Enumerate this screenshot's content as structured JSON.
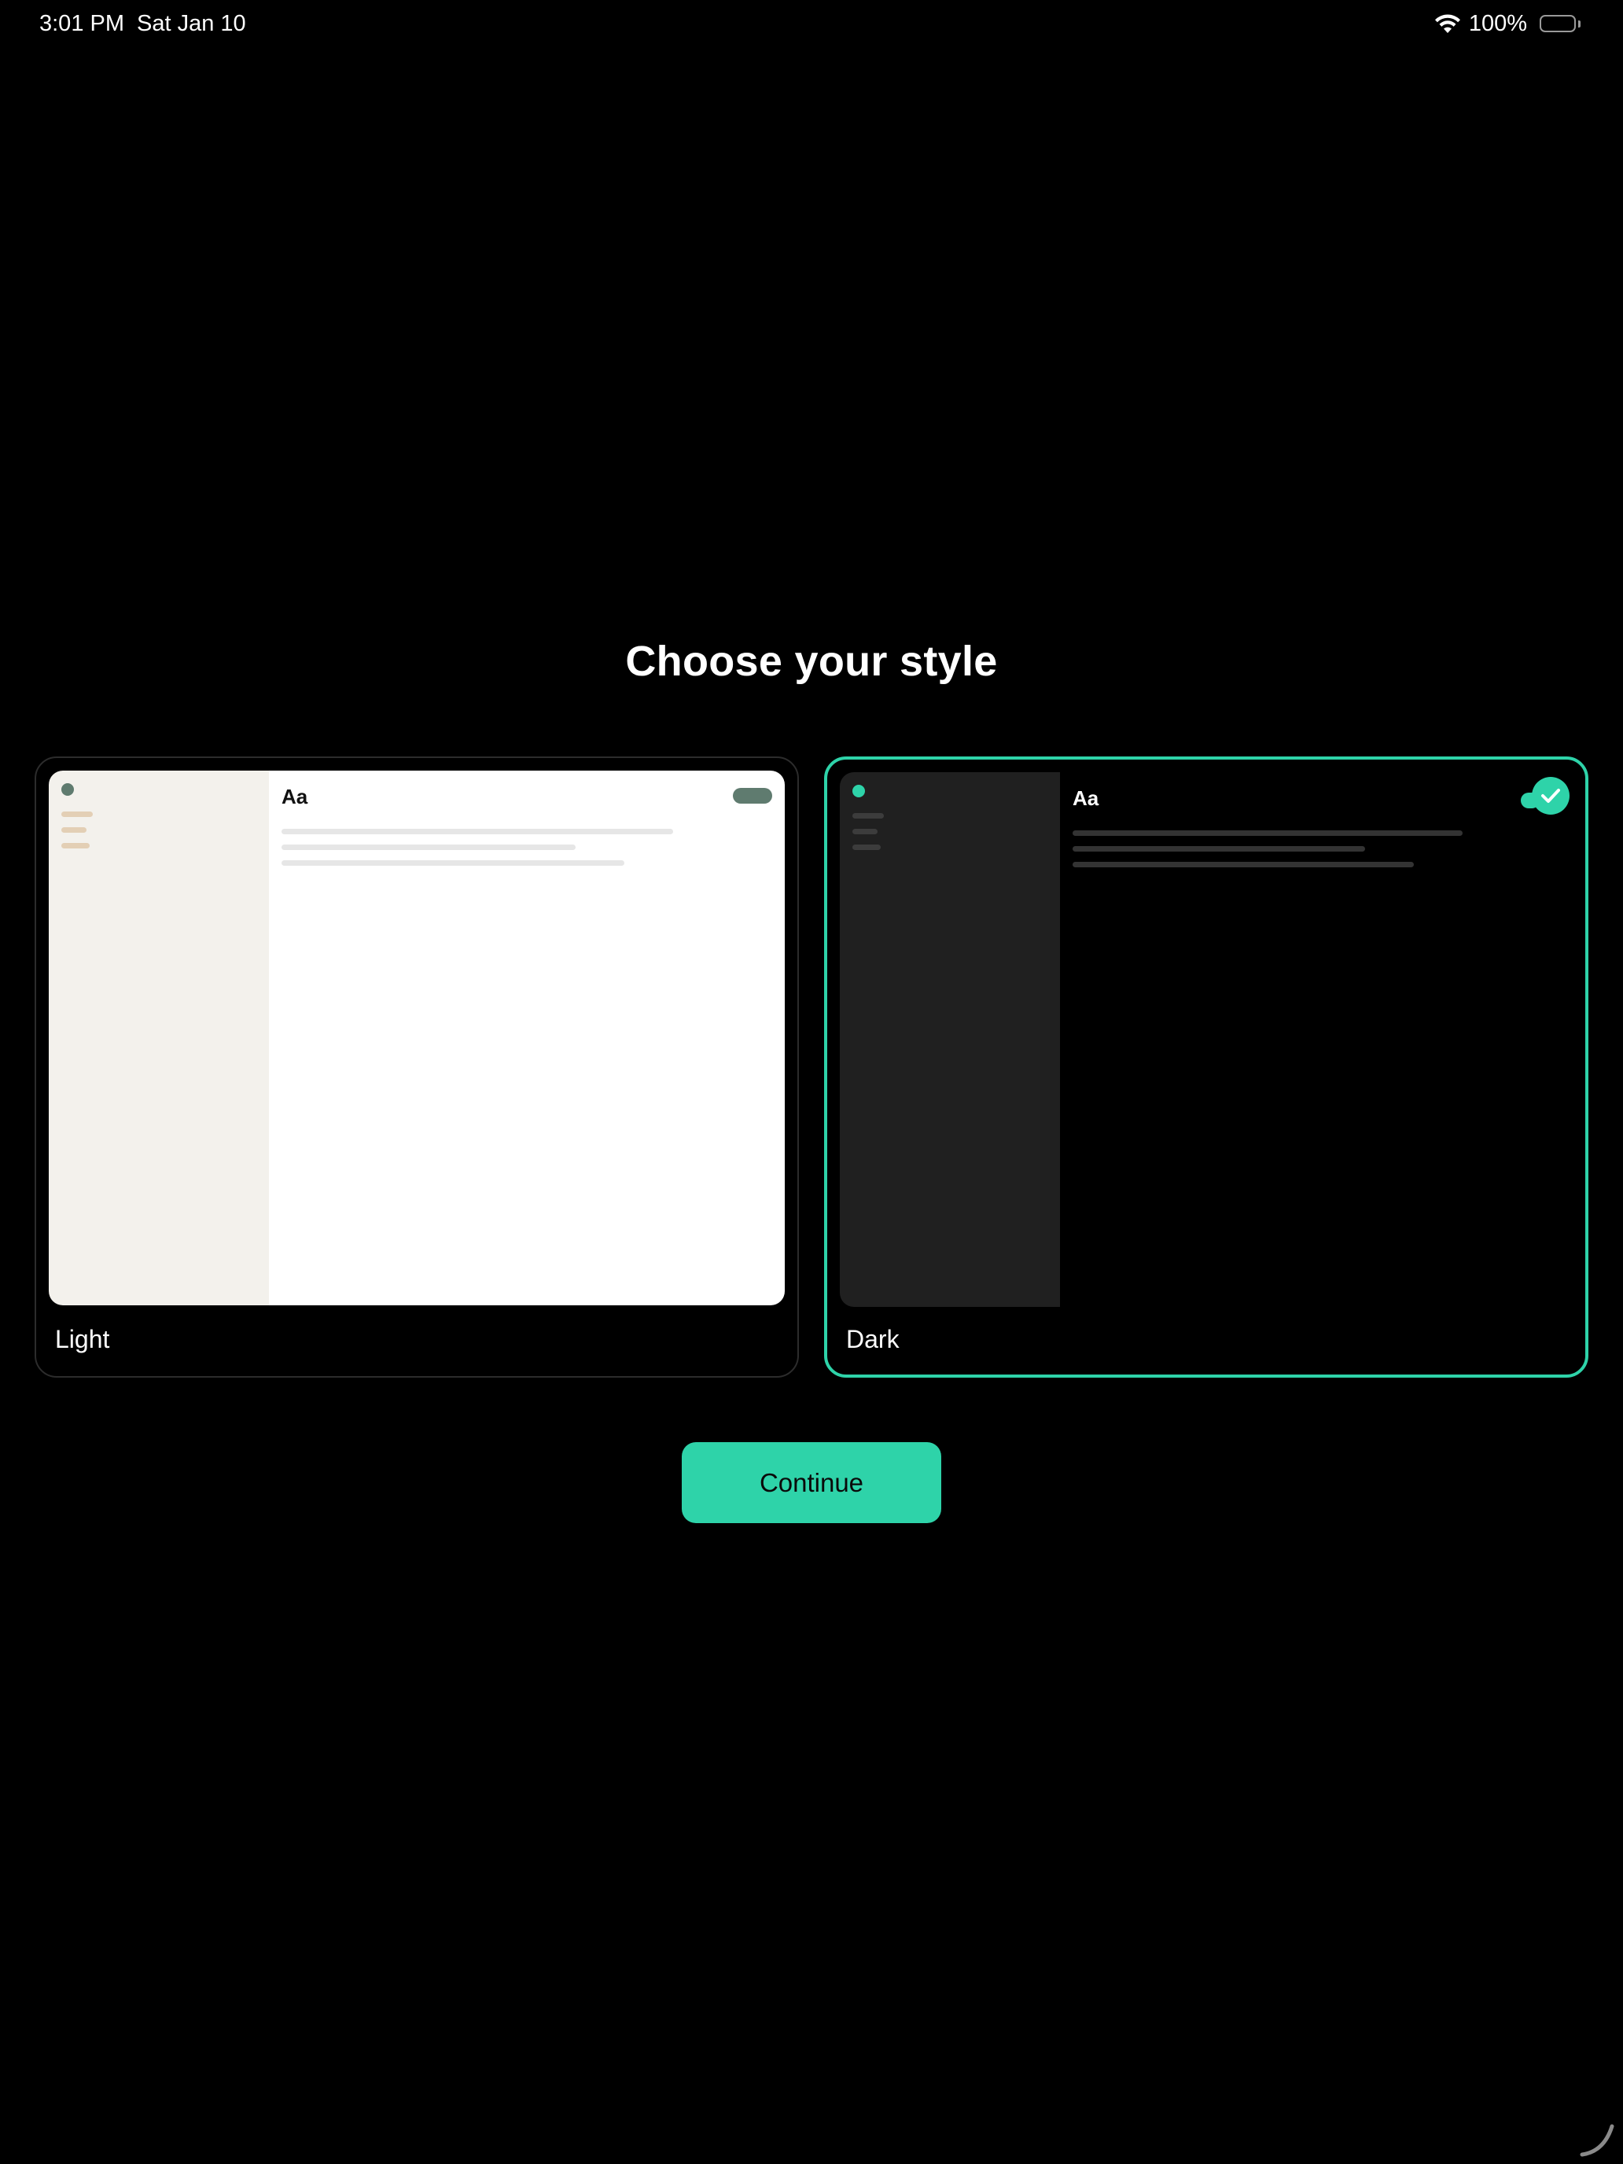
{
  "status_bar": {
    "time": "3:01 PM",
    "date": "Sat Jan 10",
    "battery_percent": "100%",
    "battery_level": 1.0,
    "icons": [
      "wifi-icon",
      "battery-icon"
    ]
  },
  "title": "Choose your style",
  "options": [
    {
      "label": "Light",
      "preview_heading": "Aa",
      "selected": false
    },
    {
      "label": "Dark",
      "preview_heading": "Aa",
      "selected": true
    }
  ],
  "continue_label": "Continue",
  "colors": {
    "accent": "#2ed3a9",
    "background": "#000000",
    "light_sidebar": "#f3f1ec",
    "light_accent": "#5f7b6f",
    "dark_sidebar": "#202020"
  }
}
